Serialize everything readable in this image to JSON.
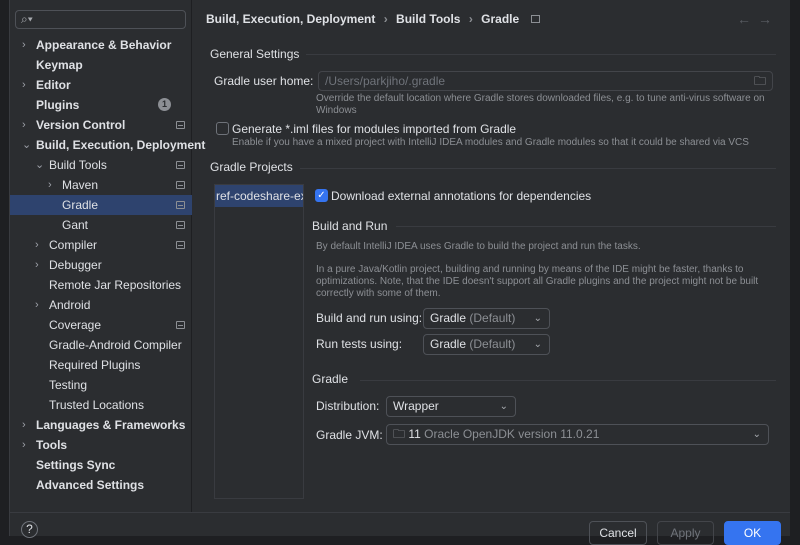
{
  "sidebar": {
    "items": [
      {
        "label": "Appearance & Behavior",
        "expand": "›"
      },
      {
        "label": "Keymap"
      },
      {
        "label": "Editor",
        "expand": "›"
      },
      {
        "label": "Plugins",
        "badge": "1"
      },
      {
        "label": "Version Control",
        "expand": "›"
      },
      {
        "label": "Build, Execution, Deployment",
        "expand": "⌄"
      },
      {
        "label": "Build Tools",
        "expand": "⌄"
      },
      {
        "label": "Maven",
        "expand": "›"
      },
      {
        "label": "Gradle"
      },
      {
        "label": "Gant"
      },
      {
        "label": "Compiler",
        "expand": "›"
      },
      {
        "label": "Debugger",
        "expand": "›"
      },
      {
        "label": "Remote Jar Repositories"
      },
      {
        "label": "Android",
        "expand": "›"
      },
      {
        "label": "Coverage"
      },
      {
        "label": "Gradle-Android Compiler"
      },
      {
        "label": "Required Plugins"
      },
      {
        "label": "Testing"
      },
      {
        "label": "Trusted Locations"
      },
      {
        "label": "Languages & Frameworks",
        "expand": "›"
      },
      {
        "label": "Tools",
        "expand": "›"
      },
      {
        "label": "Settings Sync"
      },
      {
        "label": "Advanced Settings"
      }
    ]
  },
  "breadcrumb": [
    "Build, Execution, Deployment",
    "Build Tools",
    "Gradle"
  ],
  "general": {
    "title": "General Settings",
    "user_home_label": "Gradle user home:",
    "user_home_placeholder": "/Users/parkjiho/.gradle",
    "user_home_help": "Override the default location where Gradle stores downloaded files, e.g. to tune anti-virus software on",
    "user_home_help2": "Windows",
    "iml_label": "Generate *.iml files for modules imported from Gradle",
    "iml_help": "Enable if you have a mixed project with IntelliJ IDEA modules and Gradle modules so that it could be shared via VCS"
  },
  "projects": {
    "title": "Gradle Projects",
    "items": [
      "ref-codeshare-ex"
    ],
    "download_label": "Download external annotations for dependencies"
  },
  "build_run": {
    "title": "Build and Run",
    "desc1": "By default IntelliJ IDEA uses Gradle to build the project and run the tasks.",
    "desc2": "In a pure Java/Kotlin project, building and running by means of the IDE might be faster, thanks to",
    "desc3": "optimizations. Note, that the IDE doesn't support all Gradle plugins and the project might not be built",
    "desc4": "correctly with some of them.",
    "build_label": "Build and run using:",
    "build_value": "Gradle",
    "build_suffix": "(Default)",
    "test_label": "Run tests using:",
    "test_value": "Gradle",
    "test_suffix": "(Default)"
  },
  "gradle": {
    "title": "Gradle",
    "dist_label": "Distribution:",
    "dist_value": "Wrapper",
    "jvm_label": "Gradle JVM:",
    "jvm_version": "11",
    "jvm_name": "Oracle OpenJDK version 11.0.21"
  },
  "footer": {
    "help": "?",
    "cancel": "Cancel",
    "apply": "Apply",
    "ok": "OK"
  },
  "colors": {
    "accent": "#3574f0",
    "selection": "#2e436e"
  }
}
